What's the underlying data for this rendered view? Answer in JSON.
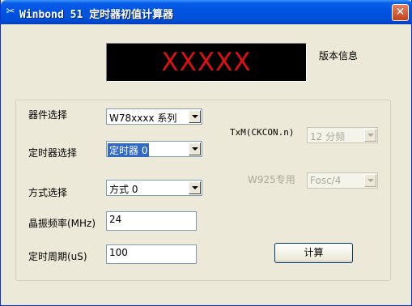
{
  "window": {
    "title": "Winbond 51 定时器初值计算器",
    "icon": "tools-icon",
    "close_label": "✕"
  },
  "display": {
    "value": "XXXXX",
    "color": "#e01010"
  },
  "version_label": "版本信息",
  "fields": {
    "device_label": "器件选择",
    "device_value": "W78xxxx 系列",
    "timer_label": "定时器选择",
    "timer_value": "定时器 0",
    "mode_label": "方式选择",
    "mode_value": "方式 0",
    "freq_label": "晶振频率(MHz)",
    "freq_value": "24",
    "period_label": "定时周期(uS)",
    "period_value": "100",
    "txm_label": "TxM(CKCON.n)",
    "txm_value": "12 分频",
    "w925_label": "W925专用",
    "w925_value": "Fosc/4"
  },
  "calculate_label": "计算"
}
